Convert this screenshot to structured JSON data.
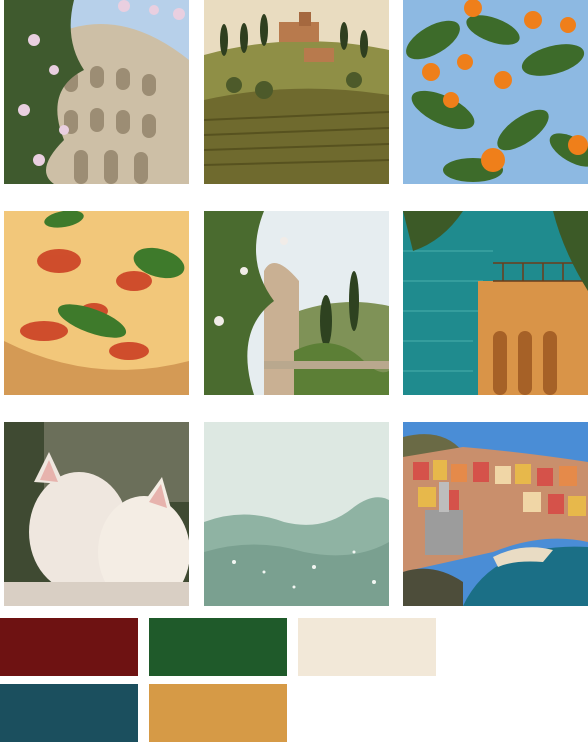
{
  "grid": {
    "tiles": [
      {
        "subject": "colosseum",
        "colors": {
          "sky": "#b7d0ea",
          "stone": "#cdbfa6",
          "foliage": "#3f5a2e",
          "flower": "#e9cfe0"
        }
      },
      {
        "subject": "tuscan-hills",
        "colors": {
          "sky": "#e9dcc0",
          "hill": "#8f8f46",
          "field": "#6f6a2e",
          "villa": "#b87a4d",
          "cypress": "#2f3f1f"
        }
      },
      {
        "subject": "orange-tree",
        "colors": {
          "sky": "#8db9e2",
          "leaf": "#3d6b2a",
          "orange": "#ef7f1a"
        }
      },
      {
        "subject": "margherita-pizza",
        "colors": {
          "cheese": "#f2c77a",
          "sauce": "#c9381f",
          "basil": "#3e7a2b",
          "crust": "#d49a55"
        }
      },
      {
        "subject": "garden-terrace-view",
        "colors": {
          "sky": "#e6edf0",
          "foliage": "#4a6b2f",
          "wall": "#c9b093",
          "cypress": "#2e4220"
        }
      },
      {
        "subject": "seaside-balcony",
        "colors": {
          "sea": "#1f8b8e",
          "building": "#d99448",
          "tree": "#3c5a27"
        }
      },
      {
        "subject": "kittens",
        "colors": {
          "background": "#3f4a32",
          "fur": "#efe7df",
          "ear": "#e7b3ad"
        }
      },
      {
        "subject": "sea-wave",
        "colors": {
          "sky": "#dde8e2",
          "water": "#8fb3a3"
        }
      },
      {
        "subject": "cinque-terre-village",
        "colors": {
          "sky": "#4a8dd6",
          "sea": "#1b6f86",
          "house_red": "#d5524a",
          "house_yellow": "#e7b84b",
          "cliff": "#6a6a45"
        }
      }
    ]
  },
  "palette": {
    "swatches": [
      {
        "color": "#6e1212"
      },
      {
        "color": "#1f5a2a"
      },
      {
        "color": "#f2e8d8"
      },
      {
        "color": "#1b4f5e"
      },
      {
        "color": "#d69a46"
      }
    ]
  }
}
